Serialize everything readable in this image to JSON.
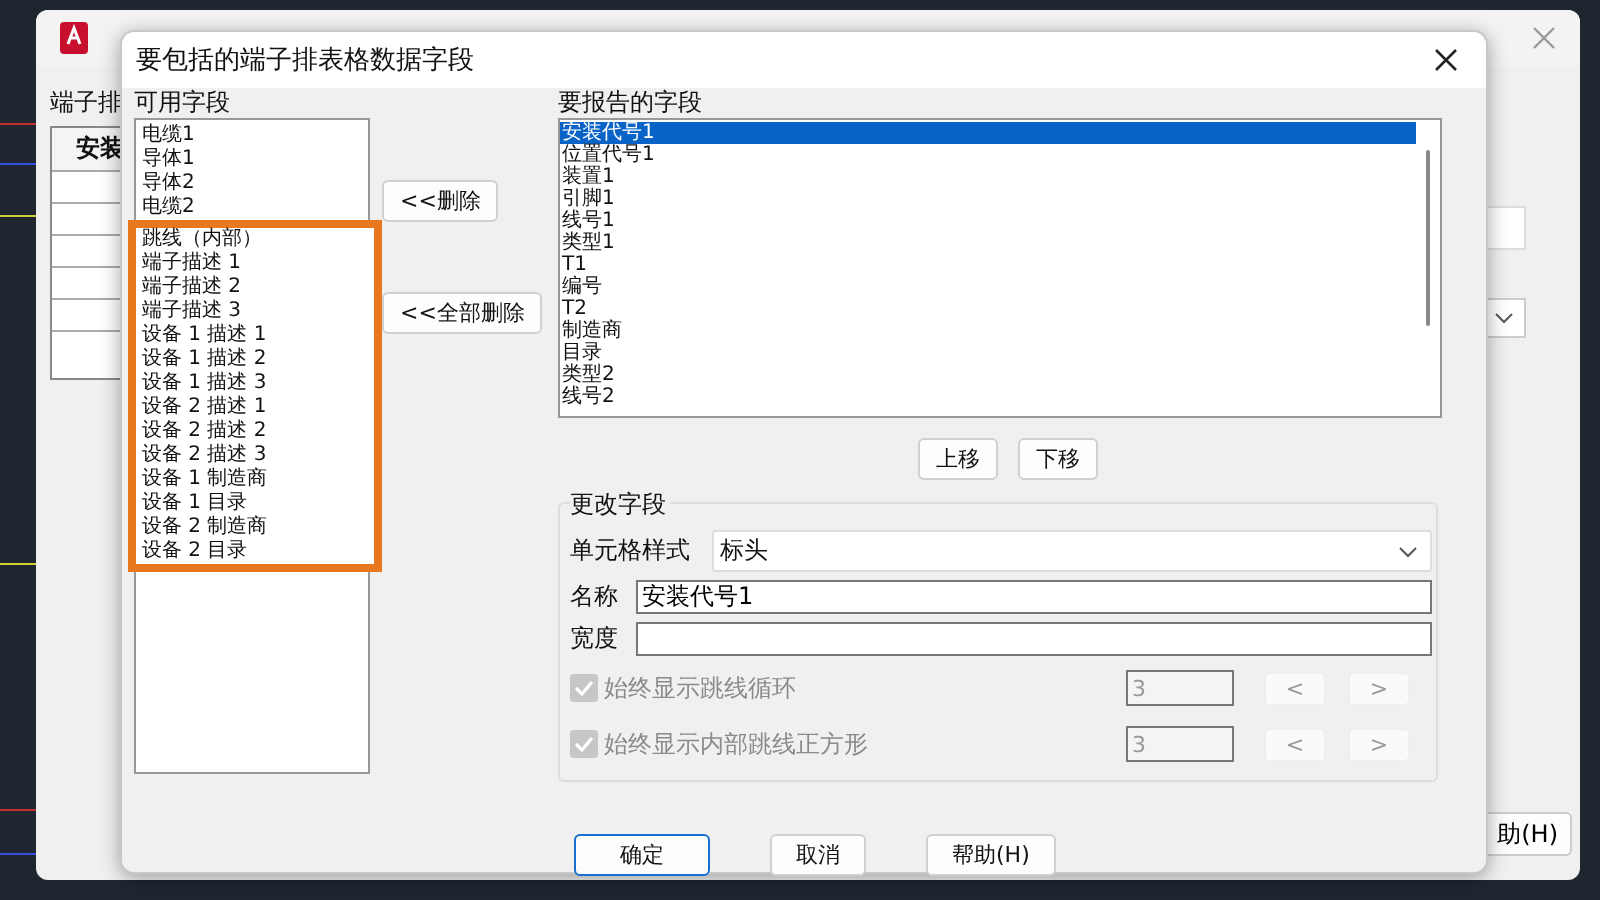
{
  "background_window": {
    "section_label": "端子排",
    "table_header": "安装",
    "button": "助(H)"
  },
  "dialog": {
    "title": "要包括的端子排表格数据字段",
    "available_label": "可用字段",
    "available_fields": [
      {
        "label": "电缆1",
        "highlighted": false
      },
      {
        "label": "导体1",
        "highlighted": false
      },
      {
        "label": "导体2",
        "highlighted": false
      },
      {
        "label": "电缆2",
        "highlighted": false
      },
      {
        "label": "跳线（内部）",
        "highlighted": true
      },
      {
        "label": "端子描述 1",
        "highlighted": true
      },
      {
        "label": "端子描述 2",
        "highlighted": true
      },
      {
        "label": "端子描述 3",
        "highlighted": true
      },
      {
        "label": "设备 1 描述 1",
        "highlighted": true
      },
      {
        "label": "设备 1 描述 2",
        "highlighted": true
      },
      {
        "label": "设备 1 描述 3",
        "highlighted": true
      },
      {
        "label": "设备 2 描述 1",
        "highlighted": true
      },
      {
        "label": "设备 2 描述 2",
        "highlighted": true
      },
      {
        "label": "设备 2 描述 3",
        "highlighted": true
      },
      {
        "label": "设备 1 制造商",
        "highlighted": true
      },
      {
        "label": "设备 1 目录",
        "highlighted": true
      },
      {
        "label": "设备 2 制造商",
        "highlighted": true
      },
      {
        "label": "设备 2 目录",
        "highlighted": true
      }
    ],
    "remove_button": "<<删除",
    "remove_all_button": "<<全部删除",
    "reported_label": "要报告的字段",
    "reported_fields": [
      {
        "label": "安装代号1",
        "selected": true
      },
      {
        "label": "位置代号1",
        "selected": false
      },
      {
        "label": "装置1",
        "selected": false
      },
      {
        "label": "引脚1",
        "selected": false
      },
      {
        "label": "线号1",
        "selected": false
      },
      {
        "label": "类型1",
        "selected": false
      },
      {
        "label": "T1",
        "selected": false
      },
      {
        "label": "编号",
        "selected": false
      },
      {
        "label": "T2",
        "selected": false
      },
      {
        "label": "制造商",
        "selected": false
      },
      {
        "label": "目录",
        "selected": false
      },
      {
        "label": "类型2",
        "selected": false
      },
      {
        "label": "线号2",
        "selected": false
      }
    ],
    "move_up": "上移",
    "move_down": "下移",
    "change_group": {
      "title": "更改字段",
      "cell_style_label": "单元格样式",
      "cell_style_value": "标头",
      "name_label": "名称",
      "name_value": "安装代号1",
      "width_label": "宽度",
      "options": [
        {
          "label": "始终显示跳线循环",
          "checked": true,
          "disabled": true,
          "value": "3",
          "prev": "<",
          "next": ">"
        },
        {
          "label": "始终显示内部跳线正方形",
          "checked": true,
          "disabled": true,
          "value": "3",
          "prev": "<",
          "next": ">"
        }
      ]
    },
    "buttons": [
      {
        "label": "确定",
        "default": true
      },
      {
        "label": "取消",
        "default": false
      },
      {
        "label": "帮助(H)",
        "default": false
      }
    ]
  }
}
